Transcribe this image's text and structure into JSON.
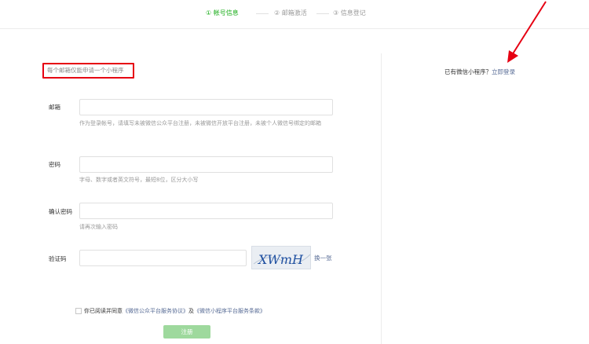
{
  "steps": [
    {
      "label": "① 帐号信息",
      "active": true
    },
    {
      "label": "② 邮箱激活",
      "active": false
    },
    {
      "label": "③ 信息登记",
      "active": false
    }
  ],
  "tip": "每个邮箱仅能申请一个小程序",
  "form": {
    "email": {
      "label": "邮箱",
      "value": "",
      "hint": "作为登录帐号，请填写未被微信公众平台注册，未被微信开放平台注册，未被个人微信号绑定的邮箱"
    },
    "password": {
      "label": "密码",
      "value": "",
      "hint": "字母、数字或者英文符号，最短8位，区分大小写"
    },
    "confirm": {
      "label": "确认密码",
      "value": "",
      "hint": "请再次输入密码"
    },
    "captcha": {
      "label": "验证码",
      "value": "",
      "image_text": "XWmH",
      "refresh_label": "换一张"
    }
  },
  "agreement": {
    "prefix": "你已阅读并同意",
    "link1": "《微信公众平台服务协议》",
    "middle": "及",
    "link2": "《微信小程序平台服务条款》"
  },
  "register_label": "注册",
  "login": {
    "prefix": "已有微信小程序？",
    "link": "立即登录"
  },
  "colors": {
    "accent": "#1aad19",
    "link": "#576b95",
    "highlight": "#e60012",
    "button_disabled": "#9ed99d"
  }
}
